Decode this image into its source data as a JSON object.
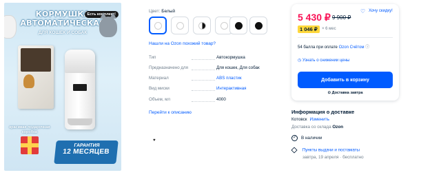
{
  "image": {
    "title_line1": "КОРМУШКА",
    "title_line2": "АВТОМАТИЧЕСКАЯ",
    "subtitle": "ДЛЯ КОШЕК И СОБАК",
    "badge": "Есть комплект!",
    "gift_text_line1": "красивая подарочная",
    "gift_text_line2": "коробка",
    "warranty_label": "ГАРАНТИЯ",
    "warranty_value": "12 МЕСЯЦЕВ"
  },
  "color": {
    "label": "Цвет:",
    "value": "Белый",
    "swatches": [
      {
        "fill": "#ffffff",
        "style": "white"
      },
      {
        "fill": "#ffffff",
        "style": "white"
      },
      {
        "fill": "#111111",
        "style": "half"
      },
      {
        "fill": "#ffffff",
        "style": "white"
      },
      {
        "fill": "#111111",
        "style": "black"
      },
      {
        "fill": "#111111",
        "style": "black"
      }
    ]
  },
  "similar_link": "Нашли на Ozon похожий товар?",
  "specs": [
    {
      "key": "Тип",
      "value": "Автокормушка",
      "is_link": false
    },
    {
      "key": "Предназначено для",
      "value": "Для кошек, Для собак",
      "is_link": false
    },
    {
      "key": "Материал",
      "value": "ABS пластик",
      "is_link": true
    },
    {
      "key": "Вид миски",
      "value": "Интерактивная",
      "is_link": true
    },
    {
      "key": "Объем, мл",
      "value": "4000",
      "is_link": false
    }
  ],
  "description_link": "Перейти к описанию",
  "price_card": {
    "price": "5 430 ₽",
    "old_price": "9 900 ₽",
    "wishlist": "Хочу скидку!",
    "installment": "1 046 ₽",
    "installment_times": "× 6 мес",
    "points_text": "54 балла при оплате",
    "points_ozon": "Ozon Счётом",
    "price_drop": "Узнать о снижении цены",
    "add_to_cart": "Добавить в корзину",
    "delivery": "Доставка завтра"
  },
  "delivery_info": {
    "title": "Информация о доставке",
    "city": "Котовск",
    "change": "Изменить",
    "warehouse_prefix": "Доставка со склада",
    "warehouse_name": "Ozon",
    "in_stock": "В наличии",
    "pickup": "Пункты выдачи и постаматы",
    "pickup_sub": "завтра, 19 апреля · бесплатно"
  },
  "colors": {
    "accent": "#005bff",
    "price": "#f91155",
    "installment_bg": "#ffd83d",
    "text": "#001a34",
    "muted": "#707f8d"
  }
}
